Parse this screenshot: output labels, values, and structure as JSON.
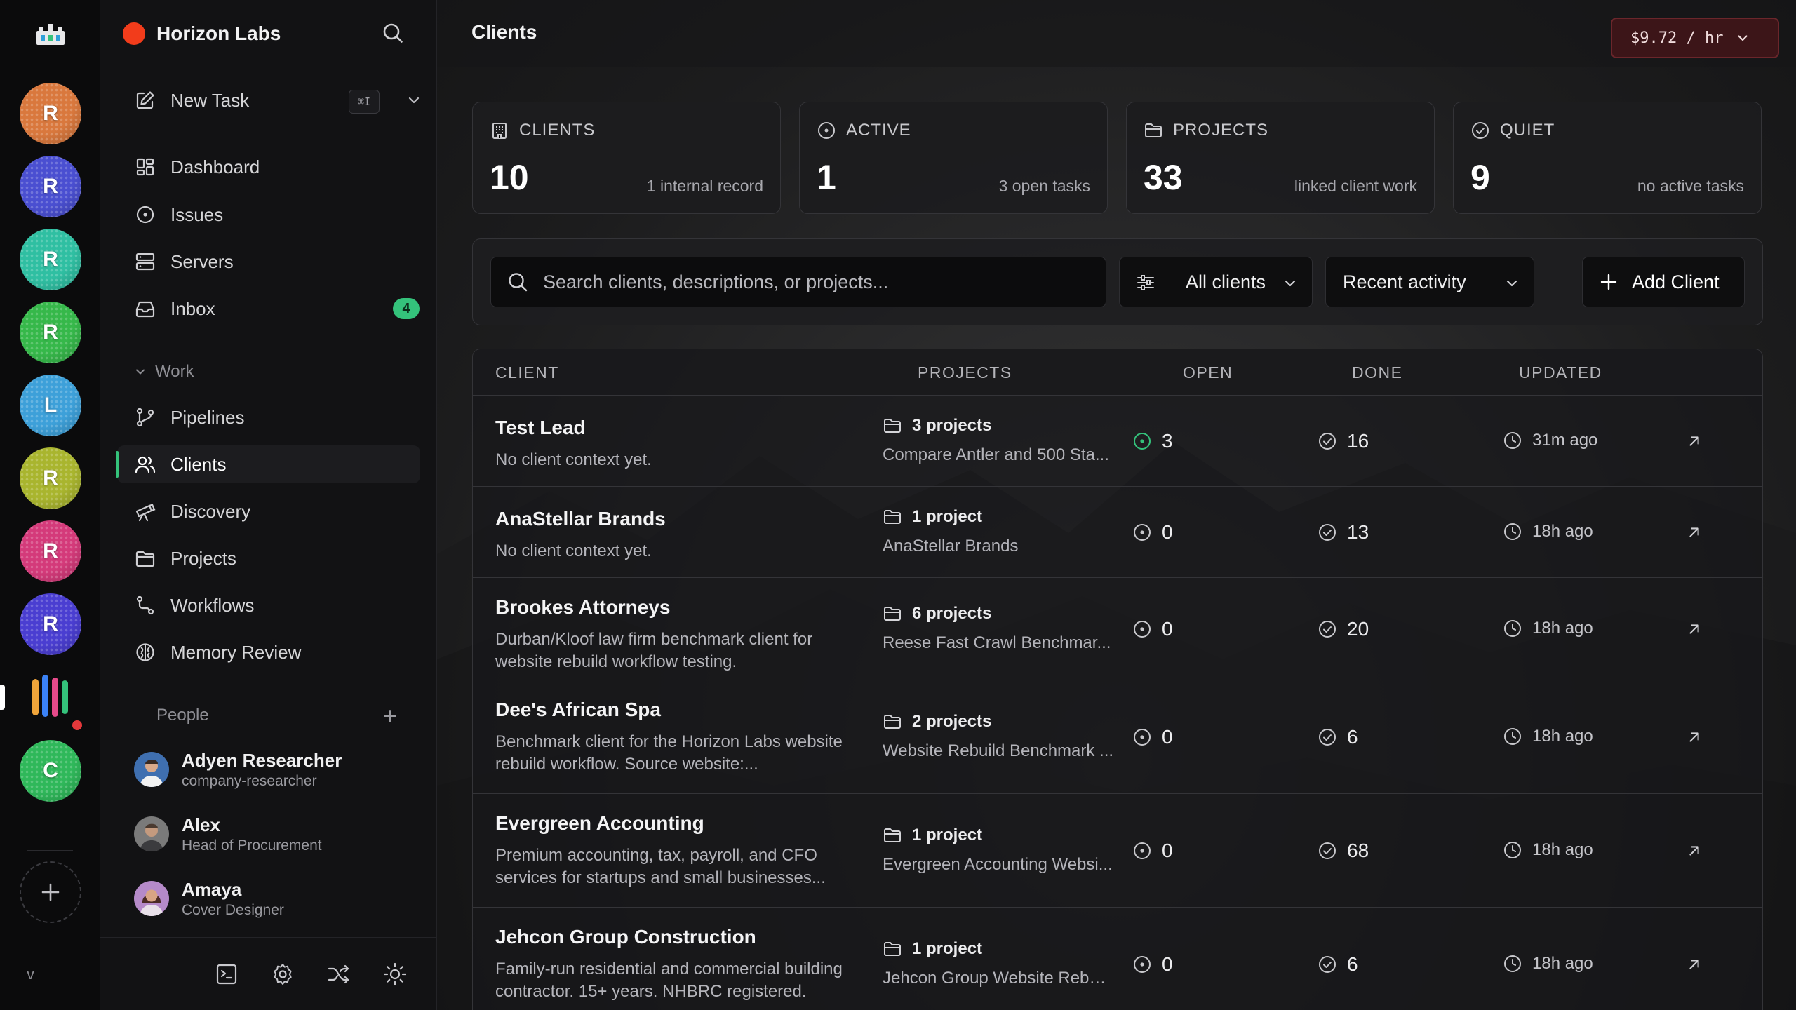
{
  "colors": {
    "accent_green": "#34c27b",
    "org_dot": "#f23c1b",
    "rate_pill_bg": "#3c1518",
    "rate_pill_border": "#6b262b",
    "alert_dot": "#e5383b"
  },
  "rail": {
    "workspaces": [
      {
        "letter": "R",
        "color": "#d9783d"
      },
      {
        "letter": "R",
        "color": "#4a4fd1"
      },
      {
        "letter": "R",
        "color": "#2fbfa2"
      },
      {
        "letter": "R",
        "color": "#36b84a"
      },
      {
        "letter": "L",
        "color": "#3da0d9"
      },
      {
        "letter": "R",
        "color": "#a9b52e"
      },
      {
        "letter": "R",
        "color": "#d43a7a"
      },
      {
        "letter": "R",
        "color": "#4a3ed1"
      },
      {
        "letter": "C",
        "color": "#2fb85a"
      }
    ],
    "version_label": "v"
  },
  "sidebar": {
    "org_name": "Horizon Labs",
    "new_task": {
      "label": "New Task",
      "shortcut": "⌘I"
    },
    "nav": [
      {
        "label": "Dashboard",
        "icon": "dashboard-icon"
      },
      {
        "label": "Issues",
        "icon": "issues-icon"
      },
      {
        "label": "Servers",
        "icon": "servers-icon"
      },
      {
        "label": "Inbox",
        "icon": "inbox-icon",
        "badge": "4"
      }
    ],
    "work_section": {
      "title": "Work",
      "items": [
        {
          "label": "Pipelines",
          "icon": "pipelines-icon"
        },
        {
          "label": "Clients",
          "icon": "clients-icon",
          "active": true
        },
        {
          "label": "Discovery",
          "icon": "telescope-icon"
        },
        {
          "label": "Projects",
          "icon": "folder-icon"
        },
        {
          "label": "Workflows",
          "icon": "workflows-icon"
        },
        {
          "label": "Memory Review",
          "icon": "brain-icon"
        }
      ]
    },
    "people_section": {
      "title": "People",
      "people": [
        {
          "name": "Adyen Researcher",
          "role": "company-researcher"
        },
        {
          "name": "Alex",
          "role": "Head of Procurement"
        },
        {
          "name": "Amaya",
          "role": "Cover Designer"
        }
      ]
    }
  },
  "header": {
    "title": "Clients",
    "rate": "$9.72 / hr"
  },
  "stats": [
    {
      "label": "CLIENTS",
      "value": "10",
      "sub": "1 internal record",
      "icon": "building-icon"
    },
    {
      "label": "ACTIVE",
      "value": "1",
      "sub": "3 open tasks",
      "icon": "active-icon"
    },
    {
      "label": "PROJECTS",
      "value": "33",
      "sub": "linked client work",
      "icon": "folder-icon"
    },
    {
      "label": "QUIET",
      "value": "9",
      "sub": "no active tasks",
      "icon": "check-circle-icon"
    }
  ],
  "filters": {
    "search_placeholder": "Search clients, descriptions, or projects...",
    "scope": "All clients",
    "sort": "Recent activity",
    "add_label": "Add Client"
  },
  "table": {
    "columns": [
      "CLIENT",
      "PROJECTS",
      "OPEN",
      "DONE",
      "UPDATED"
    ],
    "rows": [
      {
        "name": "Test Lead",
        "desc": [
          "No client context yet."
        ],
        "projects": "3 projects",
        "project_desc": "Compare Antler and 500 Sta...",
        "open": "3",
        "open_active": true,
        "done": "16",
        "updated": "31m ago"
      },
      {
        "name": "AnaStellar Brands",
        "desc": [
          "No client context yet."
        ],
        "projects": "1 project",
        "project_desc": "AnaStellar Brands",
        "open": "0",
        "open_active": false,
        "done": "13",
        "updated": "18h ago"
      },
      {
        "name": "Brookes Attorneys",
        "desc": [
          "Durban/Kloof law firm benchmark client for",
          "website rebuild workflow testing."
        ],
        "projects": "6 projects",
        "project_desc": "Reese Fast Crawl Benchmar...",
        "open": "0",
        "open_active": false,
        "done": "20",
        "updated": "18h ago"
      },
      {
        "name": "Dee's African Spa",
        "desc": [
          "Benchmark client for the Horizon Labs website",
          "rebuild workflow. Source website:..."
        ],
        "projects": "2 projects",
        "project_desc": "Website Rebuild Benchmark ...",
        "open": "0",
        "open_active": false,
        "done": "6",
        "updated": "18h ago"
      },
      {
        "name": "Evergreen Accounting",
        "desc": [
          "Premium accounting, tax, payroll, and CFO",
          "services for startups and small businesses..."
        ],
        "projects": "1 project",
        "project_desc": "Evergreen Accounting Websi...",
        "open": "0",
        "open_active": false,
        "done": "68",
        "updated": "18h ago"
      },
      {
        "name": "Jehcon Group Construction",
        "desc": [
          "Family-run residential and commercial building",
          "contractor. 15+ years. NHBRC registered."
        ],
        "projects": "1 project",
        "project_desc": "Jehcon Group Website Rebui...",
        "open": "0",
        "open_active": false,
        "done": "6",
        "updated": "18h ago"
      }
    ]
  }
}
